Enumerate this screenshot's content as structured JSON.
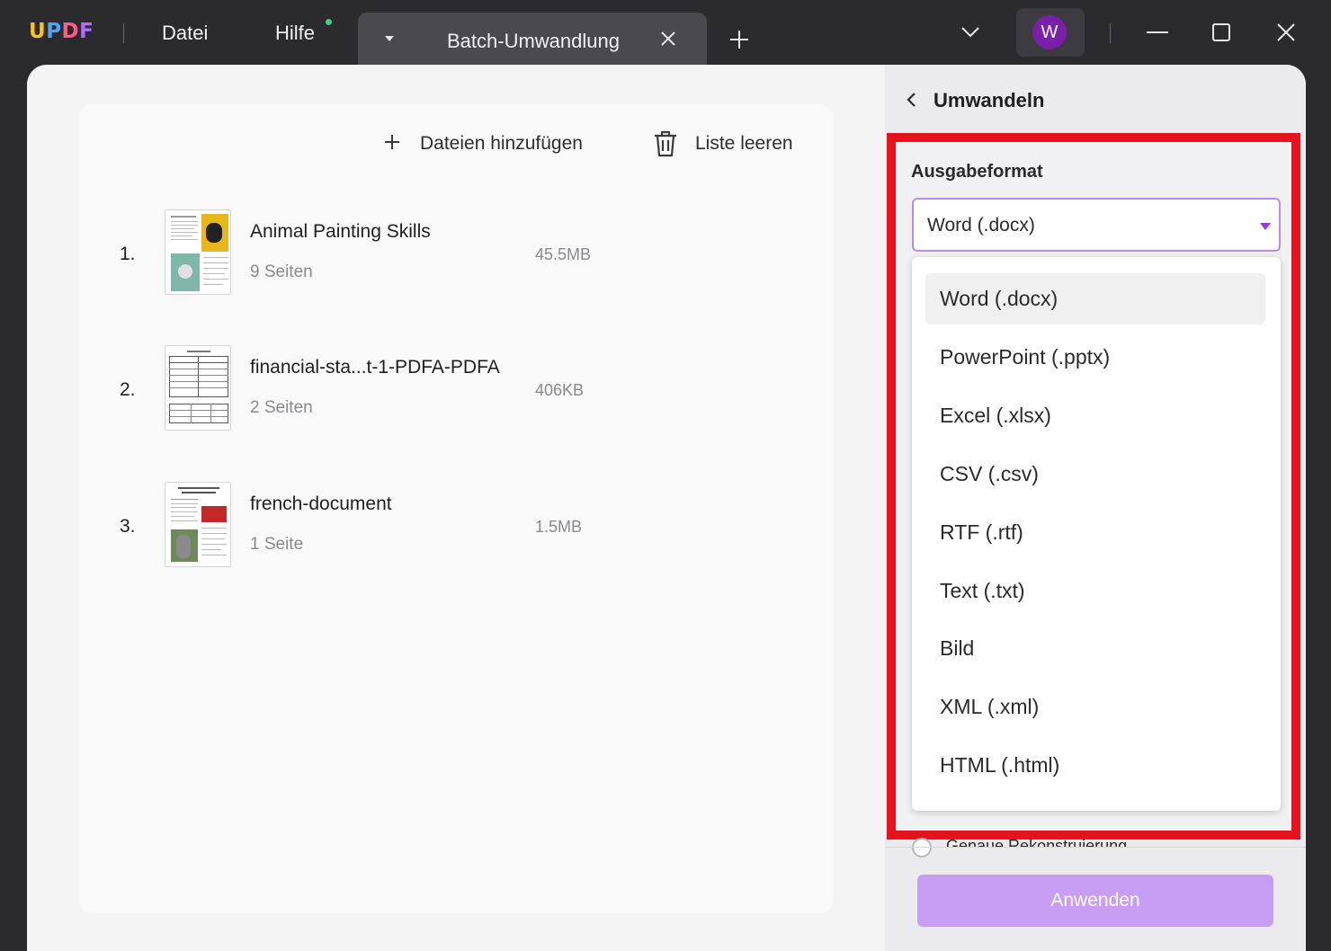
{
  "app": {
    "logo": [
      "U",
      "P",
      "D",
      "F"
    ],
    "logo_colors": [
      "#f5c518",
      "#4da3ff",
      "#ff5a8a",
      "#b06cff"
    ]
  },
  "menu": {
    "file": "Datei",
    "help": "Hilfe"
  },
  "tab": {
    "title": "Batch-Umwandlung"
  },
  "user": {
    "initial": "W",
    "avatar_color": "#7a1fa8"
  },
  "toolbar": {
    "add_files": "Dateien hinzufügen",
    "clear_list": "Liste leeren"
  },
  "files": [
    {
      "num": "1.",
      "name": "Animal Painting Skills",
      "pages": "9 Seiten",
      "size": "45.5MB"
    },
    {
      "num": "2.",
      "name": "financial-sta...t-1-PDFA-PDFA",
      "pages": "2 Seiten",
      "size": "406KB"
    },
    {
      "num": "3.",
      "name": "french-document",
      "pages": "1 Seite",
      "size": "1.5MB"
    }
  ],
  "panel": {
    "title": "Umwandeln",
    "output_label": "Ausgabeformat",
    "selected_format": "Word (.docx)",
    "formats": [
      "Word (.docx)",
      "PowerPoint (.pptx)",
      "Excel (.xlsx)",
      "CSV (.csv)",
      "RTF (.rtf)",
      "Text (.txt)",
      "Bild",
      "XML (.xml)",
      "HTML (.html)"
    ],
    "hidden_option": "Genaue Rekonstruierung",
    "apply": "Anwenden",
    "highlight_color": "#e8121f",
    "accent_color": "#8a3ee6"
  }
}
